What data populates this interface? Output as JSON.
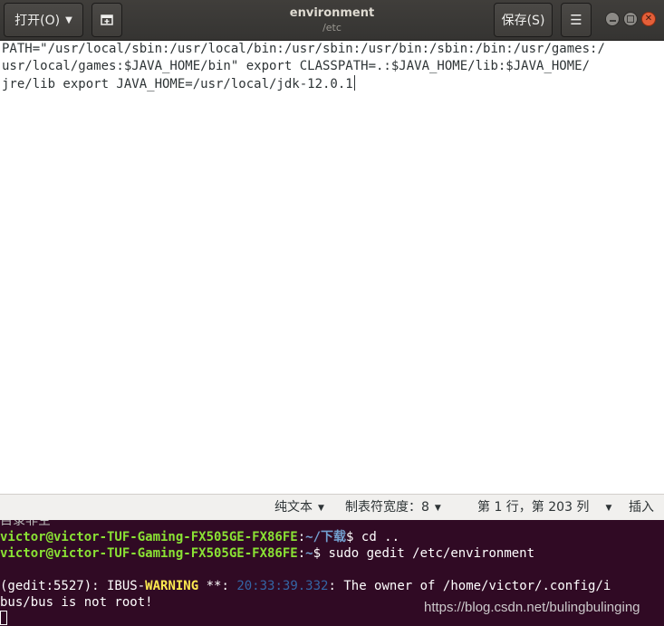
{
  "header": {
    "open_label": "打开(O)",
    "save_label": "保存(S)",
    "title": "environment",
    "subtitle": "/etc"
  },
  "editor": {
    "lines": [
      "PATH=\"/usr/local/sbin:/usr/local/bin:/usr/sbin:/usr/bin:/sbin:/bin:/usr/games:/",
      "usr/local/games:$JAVA_HOME/bin\" export CLASSPATH=.:$JAVA_HOME/lib:$JAVA_HOME/",
      "jre/lib export JAVA_HOME=/usr/local/jdk-12.0.1"
    ]
  },
  "statusbar": {
    "syntax": "纯文本",
    "tab_width": "制表符宽度：8",
    "position": "第 1 行，第 203 列",
    "insert_mode": "插入"
  },
  "terminal": {
    "partial_line": "目录非空",
    "line1_user": "victor@victor-TUF-Gaming-FX505GE-FX86FE",
    "line1_path": "~/下载",
    "line1_cmd": "$ cd ..",
    "line2_user": "victor@victor-TUF-Gaming-FX505GE-FX86FE",
    "line2_path": "~",
    "line2_cmd": "$ sudo gedit /etc/environment",
    "warn_prefix": "(gedit:5527): IBUS-",
    "warn_word": "WARNING",
    "warn_mid": " **: ",
    "warn_time": "20:33:39.332",
    "warn_msg": ": The owner of /home/victor/.config/i",
    "warn_line2": "bus/bus is not root!"
  },
  "watermark": "https://blog.csdn.net/bulingbulinging",
  "colors": {
    "terminal_bg": "#300a24",
    "prompt_user": "#8ae234",
    "prompt_path": "#729fcf",
    "warning": "#fce94f",
    "close_button": "#e45f39"
  }
}
